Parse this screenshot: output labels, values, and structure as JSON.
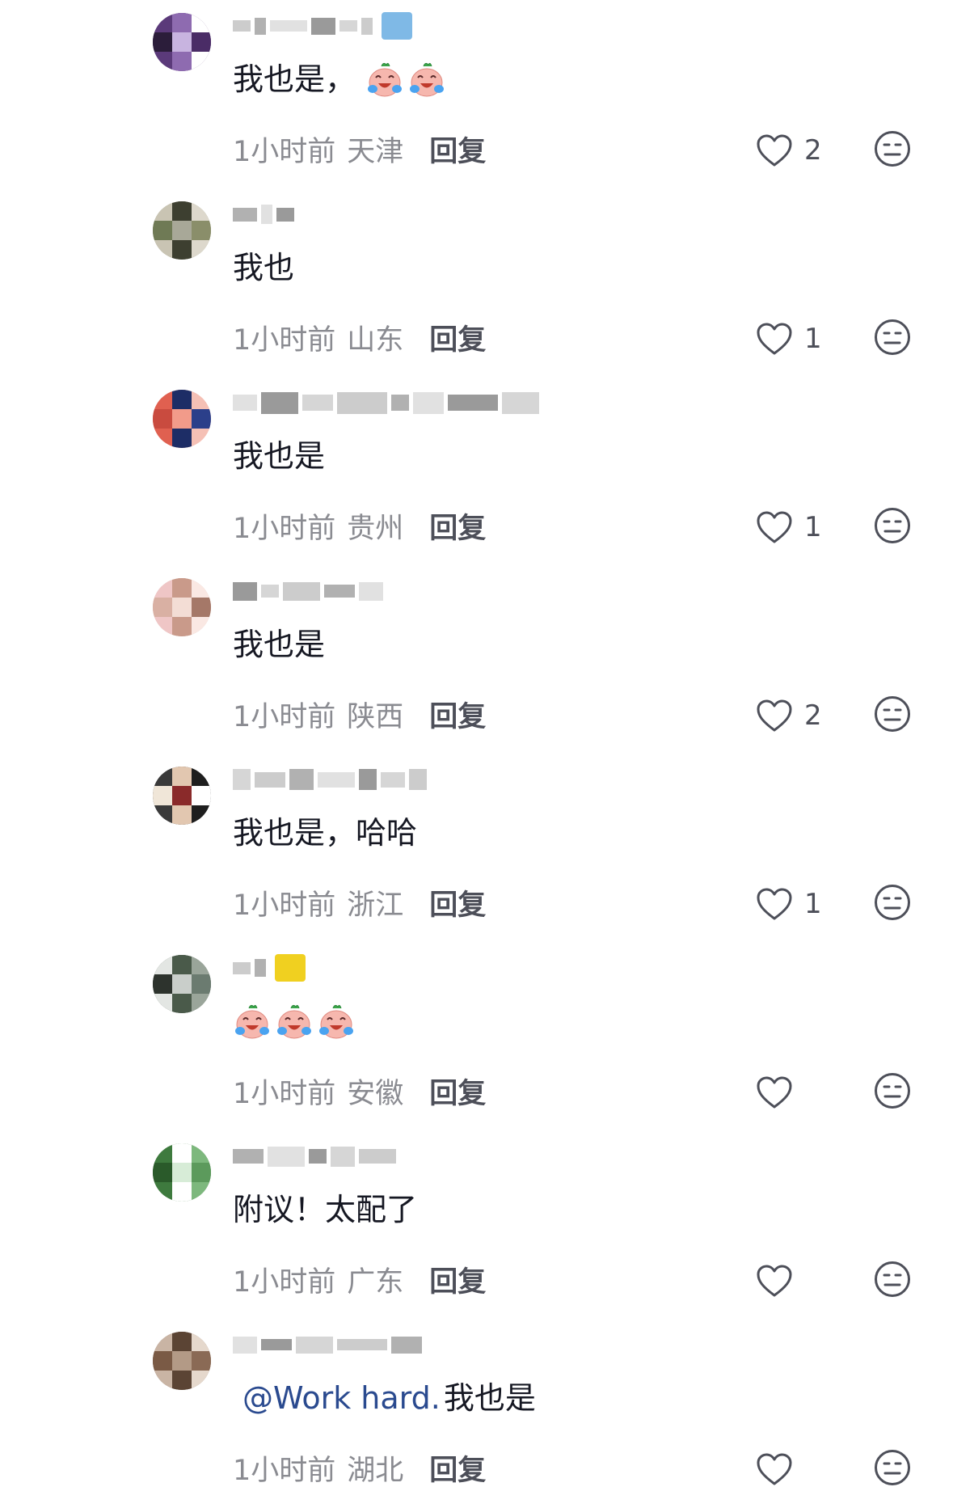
{
  "comments": [
    {
      "content": "我也是，",
      "emojis": 2,
      "mention": "",
      "time": "1小时前",
      "region": "天津",
      "reply": "回复",
      "likes": "2"
    },
    {
      "content": "我也",
      "emojis": 0,
      "mention": "",
      "time": "1小时前",
      "region": "山东",
      "reply": "回复",
      "likes": "1"
    },
    {
      "content": "我也是",
      "emojis": 0,
      "mention": "",
      "time": "1小时前",
      "region": "贵州",
      "reply": "回复",
      "likes": "1"
    },
    {
      "content": "我也是",
      "emojis": 0,
      "mention": "",
      "time": "1小时前",
      "region": "陕西",
      "reply": "回复",
      "likes": "2"
    },
    {
      "content": "我也是，哈哈",
      "emojis": 0,
      "mention": "",
      "time": "1小时前",
      "region": "浙江",
      "reply": "回复",
      "likes": "1"
    },
    {
      "content": "",
      "emojis": 3,
      "mention": "",
      "time": "1小时前",
      "region": "安徽",
      "reply": "回复",
      "likes": ""
    },
    {
      "content": "附议！太配了",
      "emojis": 0,
      "mention": "",
      "time": "1小时前",
      "region": "广东",
      "reply": "回复",
      "likes": ""
    },
    {
      "content": "我也是",
      "emojis": 0,
      "mention": "@Work hard.",
      "time": "1小时前",
      "region": "湖北",
      "reply": "回复",
      "likes": ""
    }
  ],
  "colors": {
    "text": "#161823",
    "meta": "#8a8b91",
    "mention": "#2a4a8f",
    "icon": "#4d4f59"
  },
  "icons": {
    "like": "heart-outline-icon",
    "dislike": "neutral-face-icon",
    "emoji": "crying-laughing-peach-emoji"
  }
}
